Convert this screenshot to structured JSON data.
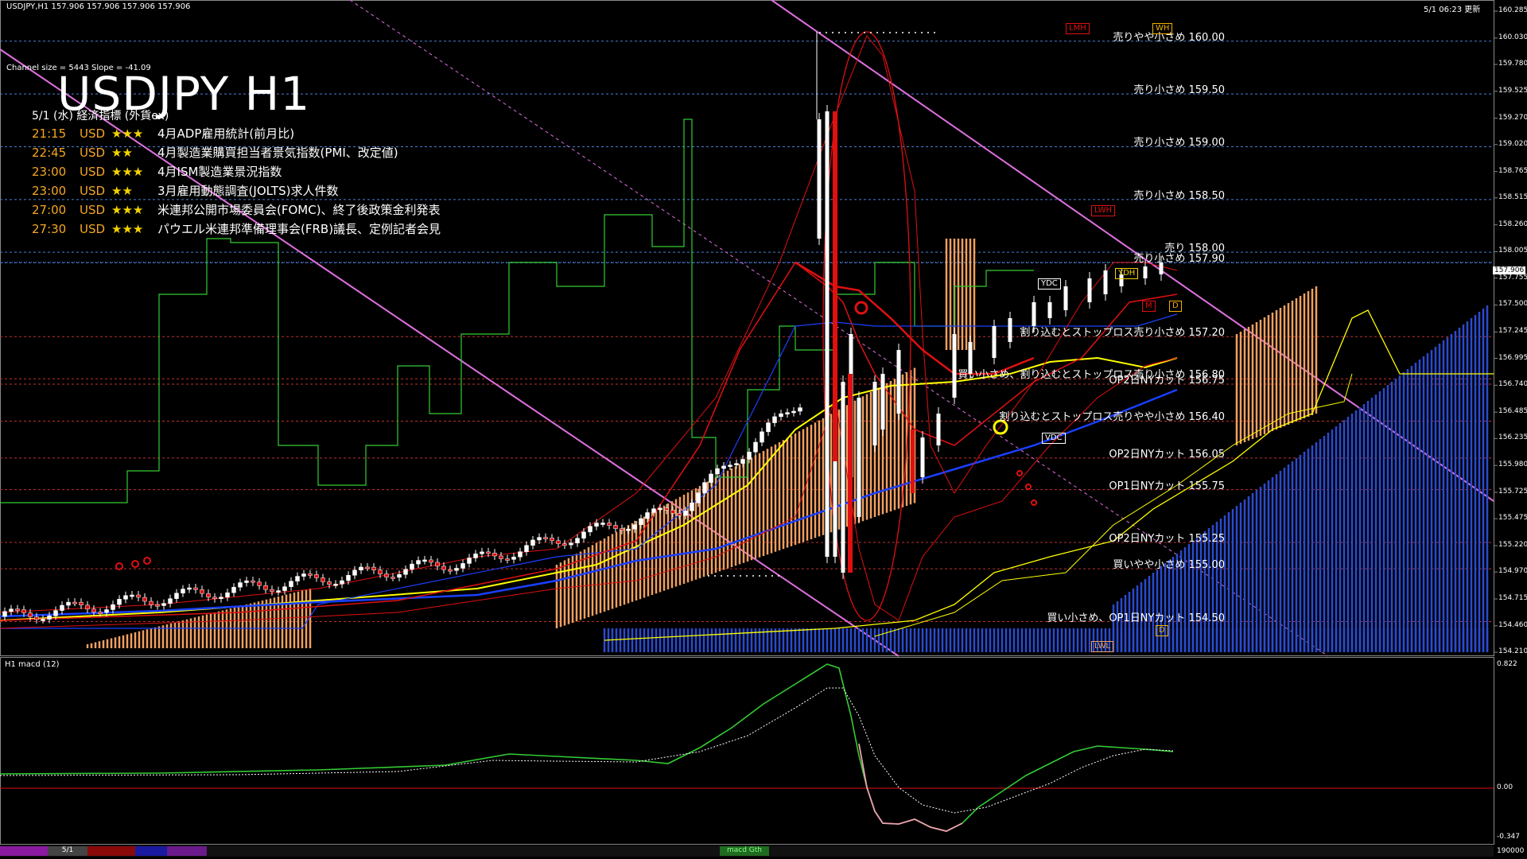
{
  "header": {
    "symbol_info": "USDJPY,H1  157.906 157.906 157.906 157.906",
    "channel_info": "Channel size = 5443  Slope = -41.09",
    "datetime": "5/1 06:23 更新"
  },
  "title": "USDJPY H1",
  "events": {
    "heading": "5/1 (水) 経済指標 (外貨ex)",
    "items": [
      {
        "time": "21:15",
        "currency": "USD",
        "stars": "★★★",
        "name": "4月ADP雇用統計(前月比)"
      },
      {
        "time": "22:45",
        "currency": "USD",
        "stars": "★★",
        "name": "4月製造業購買担当者景気指数(PMI、改定値)"
      },
      {
        "time": "23:00",
        "currency": "USD",
        "stars": "★★★",
        "name": "4月ISM製造業景況指数"
      },
      {
        "time": "23:00",
        "currency": "USD",
        "stars": "★★",
        "name": "3月雇用動態調査(JOLTS)求人件数"
      },
      {
        "time": "27:00",
        "currency": "USD",
        "stars": "★★★",
        "name": "米連邦公開市場委員会(FOMC)、終了後政策金利発表"
      },
      {
        "time": "27:30",
        "currency": "USD",
        "stars": "★★★",
        "name": "パウエル米連邦準備理事会(FRB)議長、定例記者会見"
      }
    ]
  },
  "levels": [
    {
      "label": "売りやや小さめ 160.00",
      "price": 160.0,
      "color": "#4a7fd8"
    },
    {
      "label": "売り小さめ 159.50",
      "price": 159.5,
      "color": "#4a7fd8"
    },
    {
      "label": "売り小さめ 159.00",
      "price": 159.0,
      "color": "#4a7fd8"
    },
    {
      "label": "売り小さめ 158.50",
      "price": 158.5,
      "color": "#4a7fd8"
    },
    {
      "label": "売り 158.00",
      "price": 158.0,
      "color": "#4a7fd8"
    },
    {
      "label": "売り小さめ 157.90",
      "price": 157.9,
      "color": "#4a7fd8"
    },
    {
      "label": "割り込むとストップロス売り小さめ 157.20",
      "price": 157.2,
      "color": "#c03030"
    },
    {
      "label": "買い小さめ、割り込むとストップロス売り小さめ 156.80",
      "price": 156.8,
      "color": "#c03030"
    },
    {
      "label": "OP2日NYカット 156.75",
      "price": 156.75,
      "color": "#c03030"
    },
    {
      "label": "割り込むとストップロス売りやや小さめ 156.40",
      "price": 156.4,
      "color": "#c03030"
    },
    {
      "label": "OP2日NYカット 156.05",
      "price": 156.05,
      "color": "#c03030"
    },
    {
      "label": "OP1日NYカット 155.75",
      "price": 155.75,
      "color": "#c03030"
    },
    {
      "label": "OP2日NYカット 155.25",
      "price": 155.25,
      "color": "#c03030"
    },
    {
      "label": "買いやや小さめ 155.00",
      "price": 155.0,
      "color": "#c03030"
    },
    {
      "label": "買い小さめ、OP1日NYカット 154.50",
      "price": 154.5,
      "color": "#c03030"
    }
  ],
  "price_axis": {
    "ticks": [
      "160.285",
      "160.030",
      "159.780",
      "159.525",
      "159.270",
      "159.020",
      "158.765",
      "158.515",
      "158.260",
      "158.005",
      "157.755",
      "157.500",
      "157.245",
      "156.995",
      "156.740",
      "156.485",
      "156.235",
      "155.980",
      "155.725",
      "155.475",
      "155.220",
      "154.970",
      "154.715",
      "154.460",
      "154.210"
    ],
    "current": "157.906",
    "top": 160.285,
    "bottom": 154.21
  },
  "tags": {
    "lmh": "LMH",
    "wh": "WH",
    "lwh": "LWH",
    "ydc": "YDC",
    "ydh": "YDH",
    "m": "M",
    "d": "D",
    "vdc": "VDC",
    "lwl": "LWL",
    "dl": "D"
  },
  "macd": {
    "label": "H1  macd (12)",
    "ticks": [
      "0.822",
      "0.00",
      "-0.347"
    ],
    "bottom_tick": "190000"
  },
  "bottom_tabs": {
    "date": "5/1",
    "macd_tab": "macd Gth"
  },
  "colors": {
    "green": "#33cc33",
    "yellow": "#ffff00",
    "blue": "#1a3fff",
    "red": "#e01010",
    "magenta": "#e070e0",
    "orange": "#f0a060",
    "cloud_blue": "#2a4bd0",
    "signal": "#ffffff"
  }
}
